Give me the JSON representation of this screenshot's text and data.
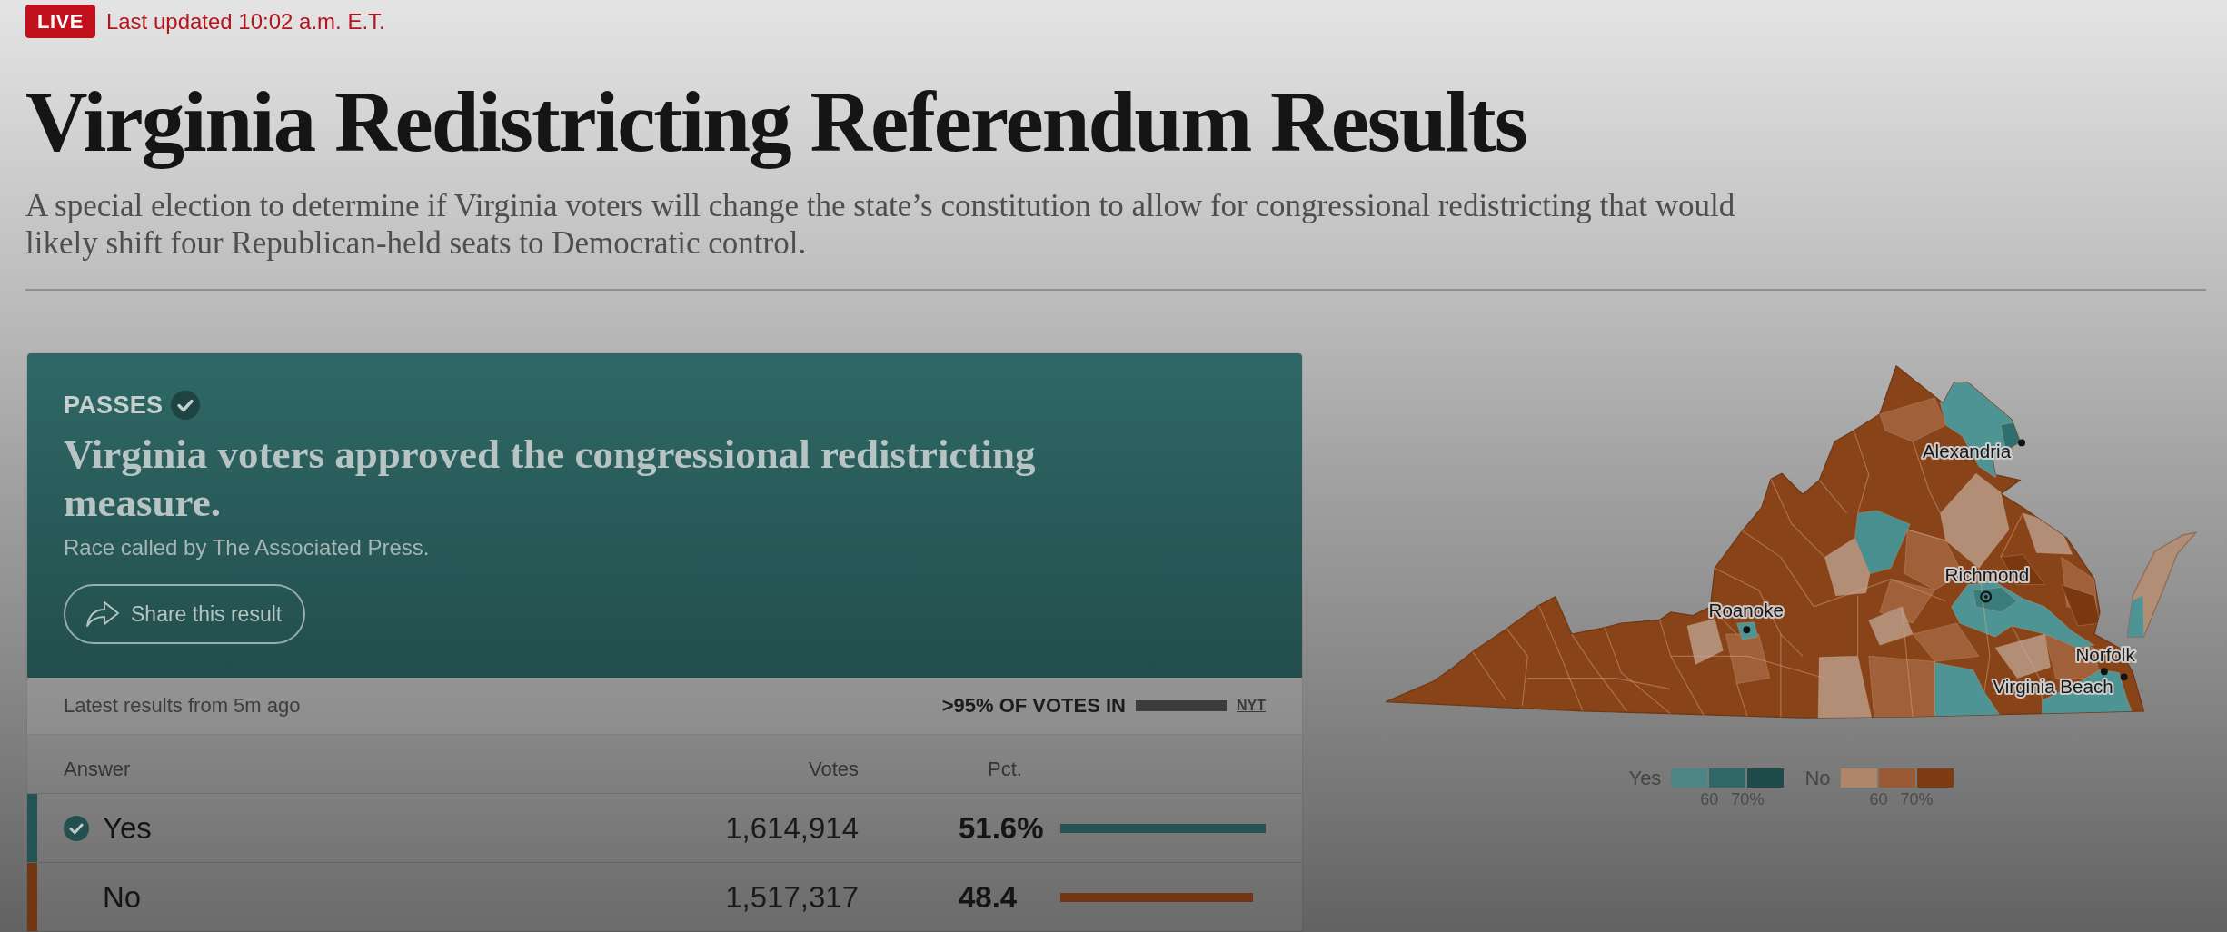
{
  "live_bar": {
    "badge": "LIVE",
    "updated": "Last updated 10:02 a.m. E.T."
  },
  "title": "Virginia Redistricting Referendum Results",
  "summary": "A special election to determine if Virginia voters will change the state’s constitution to allow for congressional redistricting that would likely shift four Republican-held seats to Democratic control.",
  "result_card": {
    "status": "PASSES",
    "headline": "Virginia voters approved the congressional redistricting measure.",
    "source": "Race called by The Associated Press.",
    "share_button": "Share this result"
  },
  "results": {
    "updated": "Latest results from 5m ago",
    "reporting": ">95% OF VOTES IN",
    "reporting_bar": {
      "level": 1
    },
    "credit": "NYT",
    "columns": [
      "Answer",
      "Votes",
      "Pct."
    ],
    "rows": [
      {
        "answer": "Yes",
        "votes": "1,614,914",
        "pct": "51.6%",
        "winner": true,
        "color": "#245554",
        "level": 1
      },
      {
        "answer": "No",
        "votes": "1,517,317",
        "pct": "48.4",
        "winner": false,
        "color": "#743512",
        "level": 0.94
      }
    ]
  },
  "map": {
    "cities": [
      {
        "name": "Alexandria",
        "kind": "city"
      },
      {
        "name": "Richmond",
        "kind": "capital"
      },
      {
        "name": "Roanoke",
        "kind": "city"
      },
      {
        "name": "Norfolk",
        "kind": "city"
      },
      {
        "name": "Virginia Beach",
        "kind": "city"
      }
    ],
    "legend": [
      {
        "label": "Yes",
        "swatches": [
          {
            "color": "#4d8584"
          },
          {
            "color": "#2f6867"
          },
          {
            "color": "#1f4c4b"
          }
        ],
        "ticks": [
          "60",
          "70%"
        ]
      },
      {
        "label": "No",
        "swatches": [
          {
            "color": "#b0866b"
          },
          {
            "color": "#9a5a33"
          },
          {
            "color": "#7e3c12"
          }
        ],
        "ticks": [
          "60",
          "70%"
        ]
      }
    ]
  }
}
